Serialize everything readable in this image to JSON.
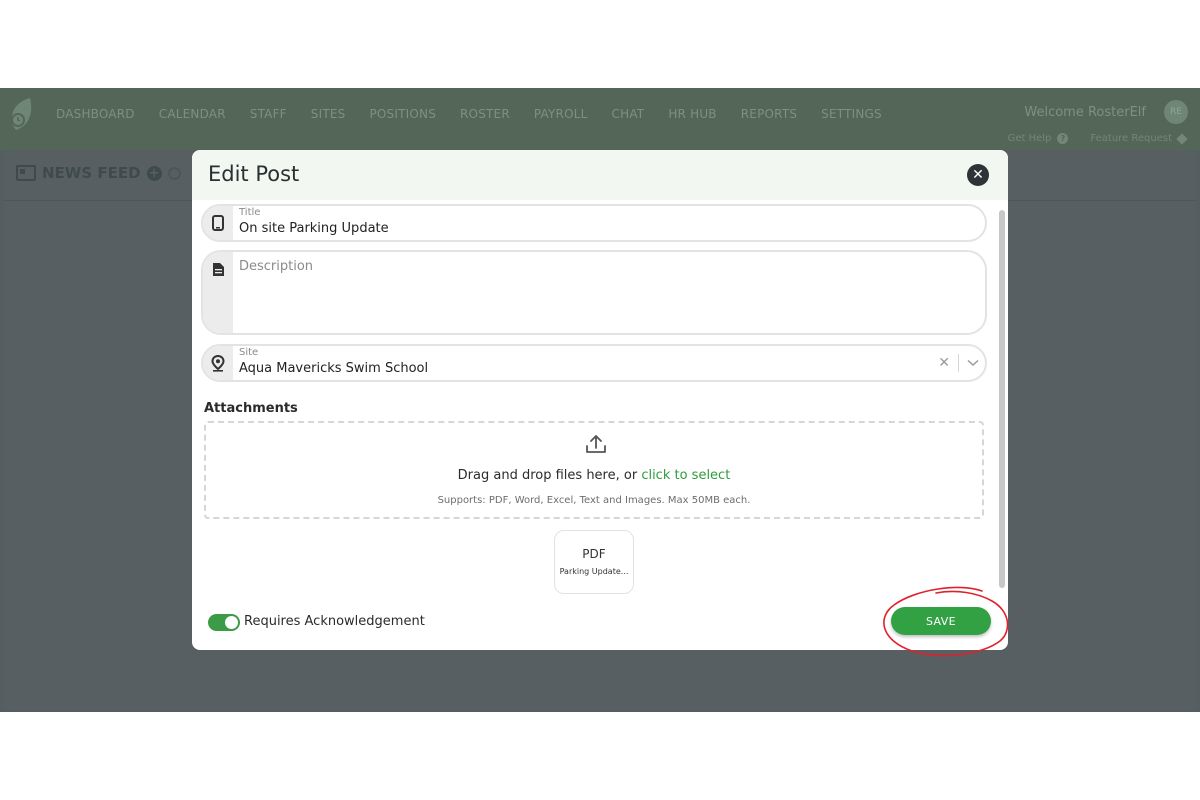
{
  "nav": {
    "items": [
      "DASHBOARD",
      "CALENDAR",
      "STAFF",
      "SITES",
      "POSITIONS",
      "ROSTER",
      "PAYROLL",
      "CHAT",
      "HR HUB",
      "REPORTS",
      "SETTINGS"
    ],
    "welcome": "Welcome RosterElf",
    "avatar_initials": "RE",
    "get_help": "Get Help",
    "feature_request": "Feature Request"
  },
  "feed": {
    "title": "NEWS FEED"
  },
  "modal": {
    "title": "Edit Post",
    "title_field": {
      "label": "Title",
      "value": "On site Parking Update"
    },
    "description_field": {
      "placeholder": "Description"
    },
    "site_field": {
      "label": "Site",
      "value": "Aqua Mavericks Swim School"
    },
    "attachments": {
      "label": "Attachments",
      "drop_text": "Drag and drop files here, or ",
      "drop_link": "click to select",
      "supports": "Supports: PDF, Word, Excel, Text and Images. Max 50MB each.",
      "file": {
        "type": "PDF",
        "name": "Parking Update..."
      }
    },
    "acknowledgement": {
      "label": "Requires Acknowledgement",
      "enabled": true
    },
    "save_label": "SAVE"
  },
  "colors": {
    "brand_green": "#31a144",
    "topbar": "#536658",
    "overlay": "#545e60",
    "highlight_circle": "#e0212b"
  }
}
